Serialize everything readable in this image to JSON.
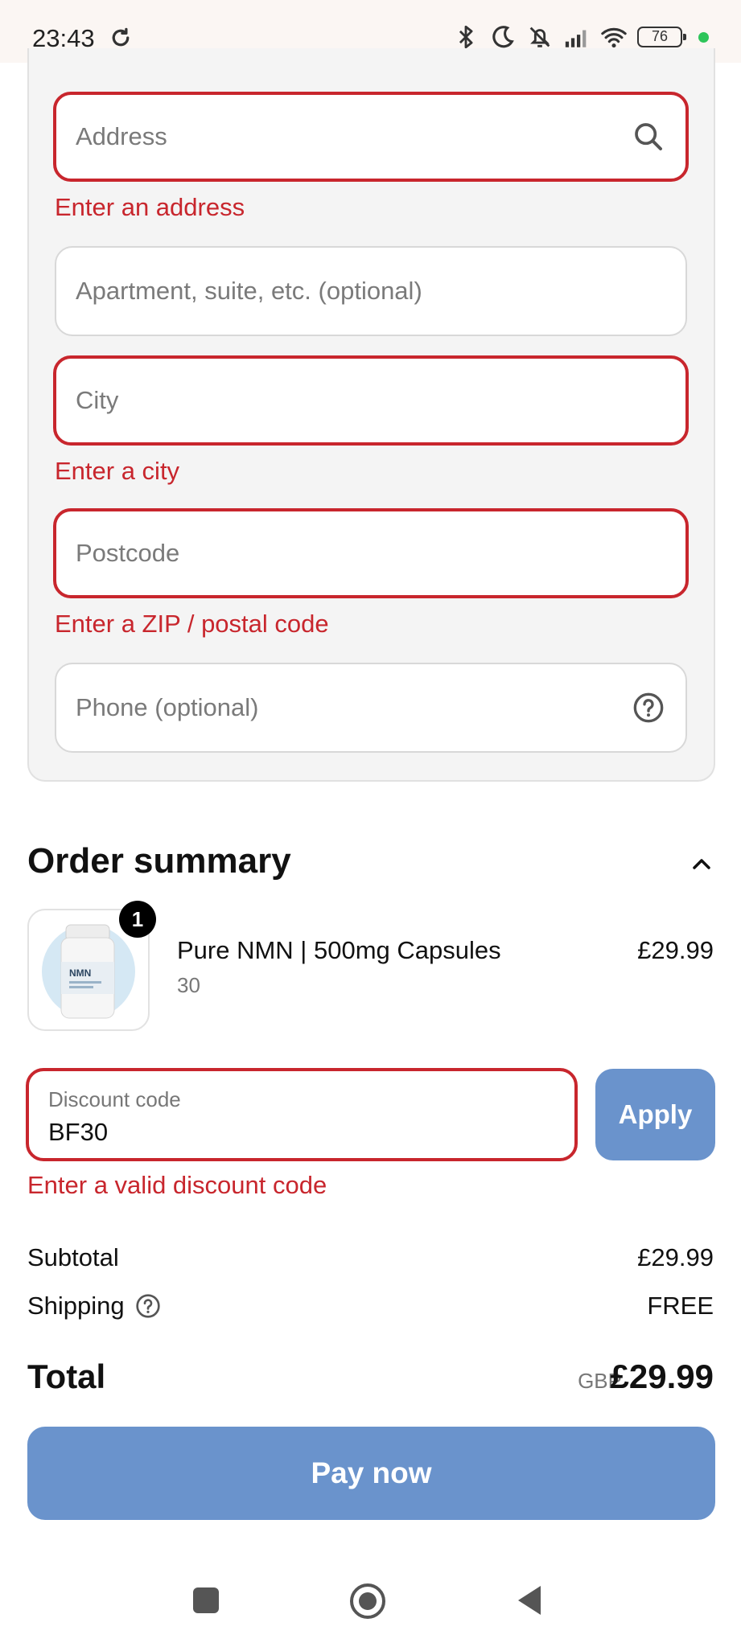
{
  "status_bar": {
    "time": "23:43",
    "battery": "76",
    "icons": [
      "sync-icon",
      "bluetooth-icon",
      "moon-icon",
      "bell-off-icon",
      "signal-icon",
      "wifi-icon",
      "battery-icon"
    ]
  },
  "address_form": {
    "address_placeholder": "Address",
    "address_error": "Enter an address",
    "apartment_placeholder": "Apartment, suite, etc. (optional)",
    "city_placeholder": "City",
    "city_error": "Enter a city",
    "postcode_placeholder": "Postcode",
    "postcode_error": "Enter a ZIP / postal code",
    "phone_placeholder": "Phone (optional)"
  },
  "order_summary": {
    "title": "Order summary",
    "item": {
      "quantity": "1",
      "name": "Pure NMN | 500mg Capsules",
      "variant": "30",
      "price": "£29.99",
      "image_text": "NMN"
    },
    "discount": {
      "label": "Discount code",
      "value": "BF30",
      "apply_label": "Apply",
      "error": "Enter a valid discount code"
    },
    "subtotal_label": "Subtotal",
    "subtotal_value": "£29.99",
    "shipping_label": "Shipping",
    "shipping_value": "FREE",
    "total_label": "Total",
    "total_currency": "GBP",
    "total_value": "£29.99",
    "pay_label": "Pay now"
  },
  "colors": {
    "error": "#c8262d",
    "primary_button": "#6a93cc",
    "card_bg": "#f4f4f4"
  }
}
